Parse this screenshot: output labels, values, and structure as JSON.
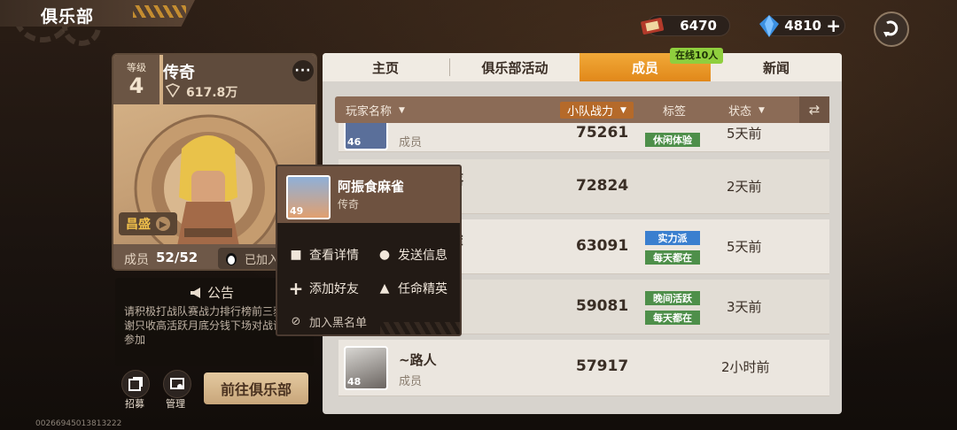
{
  "window": {
    "title": "俱乐部"
  },
  "currency": {
    "tickets": "6470",
    "gems": "4810",
    "gems_plus": "+"
  },
  "club_card": {
    "level_label": "等级",
    "level": "4",
    "name": "传奇",
    "power": "617.8万",
    "more": "···",
    "rank": "昌盛",
    "members_label": "成员",
    "members_value": "52/52",
    "joined": "已加入"
  },
  "notice": {
    "title": "公告",
    "text": "请积极打战队赛战力排行榜前三获奖 谢谢只收高活跃月底分钱下场对战请努力参加"
  },
  "bottom_actions": {
    "recruit": "招募",
    "manage": "管理",
    "go_club": "前往俱乐部"
  },
  "uid": "00266945013813222",
  "tabs": [
    {
      "label": "主页"
    },
    {
      "label": "俱乐部活动"
    },
    {
      "label": "成员"
    },
    {
      "label": "新闻"
    }
  ],
  "online_badge": "在线10人",
  "table": {
    "headers": {
      "name": "玩家名称",
      "power": "小队战力",
      "tag": "标签",
      "status": "状态"
    },
    "rows": [
      {
        "level": "46",
        "name": "",
        "role": "成员",
        "power": "75261",
        "tags": [
          "",
          "休闲体验"
        ],
        "status": "5天前"
      },
      {
        "level": "",
        "name": "落",
        "role": "",
        "power": "72824",
        "tags": [],
        "status": "2天前"
      },
      {
        "level": "",
        "name": "雀",
        "role": "",
        "power": "63091",
        "tags": [
          "实力派",
          "每天都在"
        ],
        "status": "5天前"
      },
      {
        "level": "",
        "name": "",
        "role": "",
        "power": "59081",
        "tags": [
          "晚间活跃",
          "每天都在"
        ],
        "status": "3天前"
      },
      {
        "level": "48",
        "name": "~路人",
        "role": "成员",
        "power": "57917",
        "tags": [],
        "status": "2小时前"
      }
    ]
  },
  "popup": {
    "name": "阿振食麻雀",
    "role": "传奇",
    "level": "49",
    "actions": {
      "details": "查看详情",
      "message": "发送信息",
      "add_friend": "添加好友",
      "appoint": "任命精英",
      "blacklist": "加入黑名单"
    }
  },
  "colors": {
    "accent": "#e1881a",
    "online": "#8fcf3e",
    "gold": "#f2c14b"
  }
}
